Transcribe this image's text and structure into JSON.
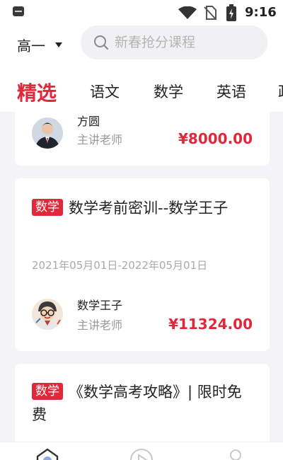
{
  "status_bar": {
    "time": "9:16",
    "icons": [
      "app-notification-icon",
      "wifi-icon",
      "no-sim-icon",
      "battery-charging-icon"
    ]
  },
  "header": {
    "grade_label": "高一",
    "search_placeholder": "新春抢分课程"
  },
  "tabs": [
    {
      "label": "精选",
      "active": true
    },
    {
      "label": "语文",
      "active": false
    },
    {
      "label": "数学",
      "active": false
    },
    {
      "label": "英语",
      "active": false
    },
    {
      "label": "政",
      "active": false
    }
  ],
  "courses": [
    {
      "teacher_name": "方圆",
      "teacher_role": "主讲老师",
      "price": "¥8000.00"
    },
    {
      "tag": "数学",
      "title": "数学考前密训--数学王子",
      "date_range": "2021年05月01日-2022年05月01日",
      "teacher_name": "数学王子",
      "teacher_role": "主讲老师",
      "price": "¥11324.00"
    },
    {
      "tag": "数学",
      "title": "《数学高考攻略》| 限时免费"
    }
  ],
  "bottom_nav": {
    "icons": [
      "home-icon",
      "play-icon",
      "profile-icon"
    ]
  },
  "colors": {
    "accent": "#e0283a",
    "background": "#f4f4f6",
    "muted_text": "#999999"
  }
}
